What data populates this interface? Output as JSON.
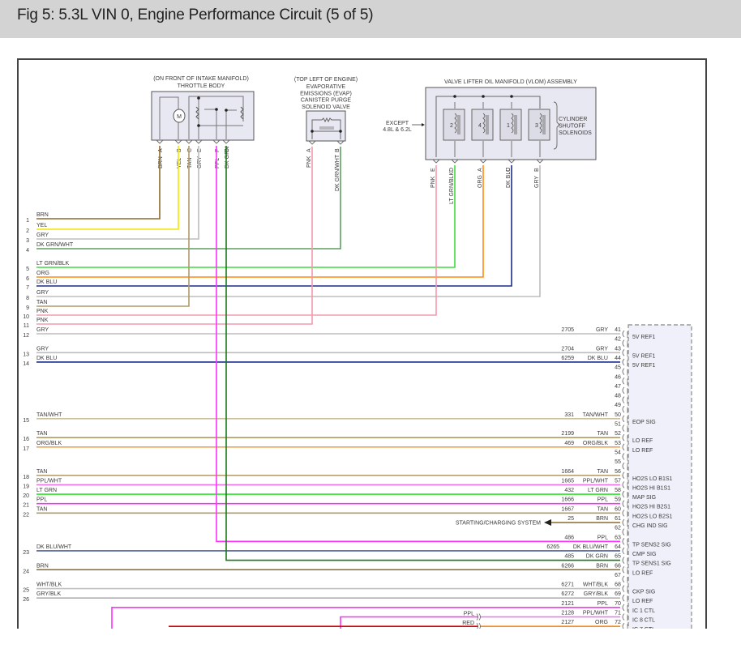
{
  "title": "Fig 5: 5.3L VIN 0, Engine Performance Circuit (5 of 5)",
  "wire_colors": {
    "BRN": "#8a6a2a",
    "YEL": "#f2e600",
    "GRY": "#bdbdbd",
    "DK GRN/WHT": "#5e9e5e",
    "LT GRN/BLK": "#3fdc3f",
    "ORG": "#ff8a10",
    "DK BLU": "#1c2c8c",
    "TAN": "#b09a6a",
    "PNK": "#f49aae",
    "TAN/WHT": "#cbbf9e",
    "ORG/BLK": "#f2a050",
    "PPL/WHT": "#f070f0",
    "LT GRN": "#2ee02e",
    "PPL": "#ff30ff",
    "DK BLU/WHT": "#50609e",
    "DK GRN": "#1a7a1a",
    "WHT/BLK": "#c0c0c0",
    "GRY/BLK": "#b0b0b0",
    "RED": "#e00000"
  },
  "throttle_body": {
    "location": "(ON FRONT OF INTAKE MANIFOLD)",
    "name": "THROTTLE BODY",
    "motor_symbol": "M",
    "pins": [
      {
        "pin": "A",
        "wire": "BRN"
      },
      {
        "pin": "B",
        "wire": "YEL"
      },
      {
        "pin": "C",
        "wire": "TAN"
      },
      {
        "pin": "E",
        "wire": "GRY"
      },
      {
        "pin": "F",
        "wire": "PPL"
      },
      {
        "pin": "D",
        "wire": "DK GRN"
      }
    ]
  },
  "evap_valve": {
    "location": "(TOP LEFT OF ENGINE)",
    "name_lines": [
      "EVAPORATIVE",
      "EMISSIONS (EVAP)",
      "CANISTER PURGE",
      "SOLENOID VALVE"
    ],
    "pins": [
      {
        "pin": "A",
        "wire": "PNK"
      },
      {
        "pin": "B",
        "wire": "DK GRN/WHT"
      }
    ]
  },
  "vlom": {
    "name": "VALVE LIFTER OIL MANIFOLD (VLOM) ASSEMBLY",
    "note_lines": [
      "EXCEPT",
      "4.8L & 6.2L"
    ],
    "solenoids": [
      "2",
      "4",
      "1",
      "3"
    ],
    "group_label_lines": [
      "CYLINDER",
      "SHUTOFF",
      "SOLENOIDS"
    ],
    "pins": [
      {
        "pin": "E",
        "wire": "PNK"
      },
      {
        "pin": "D",
        "wire": "LT GRN/BLK"
      },
      {
        "pin": "A",
        "wire": "ORG"
      },
      {
        "pin": "C",
        "wire": "DK BLU"
      },
      {
        "pin": "B",
        "wire": "GRY"
      }
    ]
  },
  "harness_wires": [
    {
      "num": "1",
      "color": "BRN"
    },
    {
      "num": "2",
      "color": "YEL"
    },
    {
      "num": "3",
      "color": "GRY"
    },
    {
      "num": "4",
      "color": "DK GRN/WHT"
    },
    {
      "num": "5",
      "color": "LT GRN/BLK"
    },
    {
      "num": "6",
      "color": "ORG"
    },
    {
      "num": "7",
      "color": "DK BLU"
    },
    {
      "num": "8",
      "color": "GRY"
    },
    {
      "num": "9",
      "color": "TAN"
    },
    {
      "num": "10",
      "color": "PNK"
    },
    {
      "num": "11",
      "color": "PNK"
    },
    {
      "num": "12",
      "color": "GRY"
    },
    {
      "num": "13",
      "color": "GRY"
    },
    {
      "num": "14",
      "color": "DK BLU"
    },
    {
      "num": "15",
      "color": "TAN/WHT"
    },
    {
      "num": "16",
      "color": "TAN"
    },
    {
      "num": "17",
      "color": "ORG/BLK"
    },
    {
      "num": "18",
      "color": "TAN"
    },
    {
      "num": "19",
      "color": "PPL/WHT"
    },
    {
      "num": "20",
      "color": "LT GRN"
    },
    {
      "num": "21",
      "color": "PPL"
    },
    {
      "num": "22",
      "color": "TAN"
    },
    {
      "num": "23",
      "color": "DK BLU/WHT"
    },
    {
      "num": "24",
      "color": "BRN"
    },
    {
      "num": "25",
      "color": "WHT/BLK"
    },
    {
      "num": "26",
      "color": "GRY/BLK"
    }
  ],
  "pcm_pins": [
    {
      "pin": "41",
      "circuit": "2705",
      "color": "GRY",
      "function": "5V REF1"
    },
    {
      "pin": "42",
      "circuit": "",
      "color": "",
      "function": ""
    },
    {
      "pin": "43",
      "circuit": "2704",
      "color": "GRY",
      "function": "5V REF1"
    },
    {
      "pin": "44",
      "circuit": "6259",
      "color": "DK BLU",
      "function": "5V REF1"
    },
    {
      "pin": "45",
      "circuit": "",
      "color": "",
      "function": ""
    },
    {
      "pin": "46",
      "circuit": "",
      "color": "",
      "function": ""
    },
    {
      "pin": "47",
      "circuit": "",
      "color": "",
      "function": ""
    },
    {
      "pin": "48",
      "circuit": "",
      "color": "",
      "function": ""
    },
    {
      "pin": "49",
      "circuit": "",
      "color": "",
      "function": ""
    },
    {
      "pin": "50",
      "circuit": "331",
      "color": "TAN/WHT",
      "function": "EOP SIG"
    },
    {
      "pin": "51",
      "circuit": "",
      "color": "",
      "function": ""
    },
    {
      "pin": "52",
      "circuit": "2199",
      "color": "TAN",
      "function": "LO REF"
    },
    {
      "pin": "53",
      "circuit": "469",
      "color": "ORG/BLK",
      "function": "LO REF"
    },
    {
      "pin": "54",
      "circuit": "",
      "color": "",
      "function": ""
    },
    {
      "pin": "55",
      "circuit": "",
      "color": "",
      "function": ""
    },
    {
      "pin": "56",
      "circuit": "1664",
      "color": "TAN",
      "function": "HO2S LO B1S1"
    },
    {
      "pin": "57",
      "circuit": "1665",
      "color": "PPL/WHT",
      "function": "HO2S HI B1S1"
    },
    {
      "pin": "58",
      "circuit": "432",
      "color": "LT GRN",
      "function": "MAP SIG"
    },
    {
      "pin": "59",
      "circuit": "1666",
      "color": "PPL",
      "function": "HO2S HI B2S1"
    },
    {
      "pin": "60",
      "circuit": "1667",
      "color": "TAN",
      "function": "HO2S LO B2S1"
    },
    {
      "pin": "61",
      "circuit": "25",
      "color": "BRN",
      "function": "CHG IND SIG"
    },
    {
      "pin": "62",
      "circuit": "",
      "color": "",
      "function": ""
    },
    {
      "pin": "63",
      "circuit": "486",
      "color": "PPL",
      "function": "TP SENS2 SIG"
    },
    {
      "pin": "64",
      "circuit": "6265",
      "color": "DK BLU/WHT",
      "function": "CMP SIG"
    },
    {
      "pin": "65",
      "circuit": "485",
      "color": "DK GRN",
      "function": "TP SENS1 SIG"
    },
    {
      "pin": "66",
      "circuit": "6266",
      "color": "BRN",
      "function": "LO REF"
    },
    {
      "pin": "67",
      "circuit": "",
      "color": "",
      "function": ""
    },
    {
      "pin": "68",
      "circuit": "6271",
      "color": "WHT/BLK",
      "function": "CKP SIG"
    },
    {
      "pin": "69",
      "circuit": "6272",
      "color": "GRY/BLK",
      "function": "LO REF"
    },
    {
      "pin": "70",
      "circuit": "2121",
      "color": "PPL",
      "function": "IC 1 CTL"
    },
    {
      "pin": "71",
      "circuit": "2128",
      "color": "PPL/WHT",
      "function": "IC 8 CTL"
    },
    {
      "pin": "72",
      "circuit": "2127",
      "color": "ORG",
      "function": "IC 7 CTL"
    }
  ],
  "starting_charging_label": "STARTING/CHARGING SYSTEM",
  "splice_labels": [
    {
      "label": "PPL"
    },
    {
      "label": "RED"
    }
  ]
}
